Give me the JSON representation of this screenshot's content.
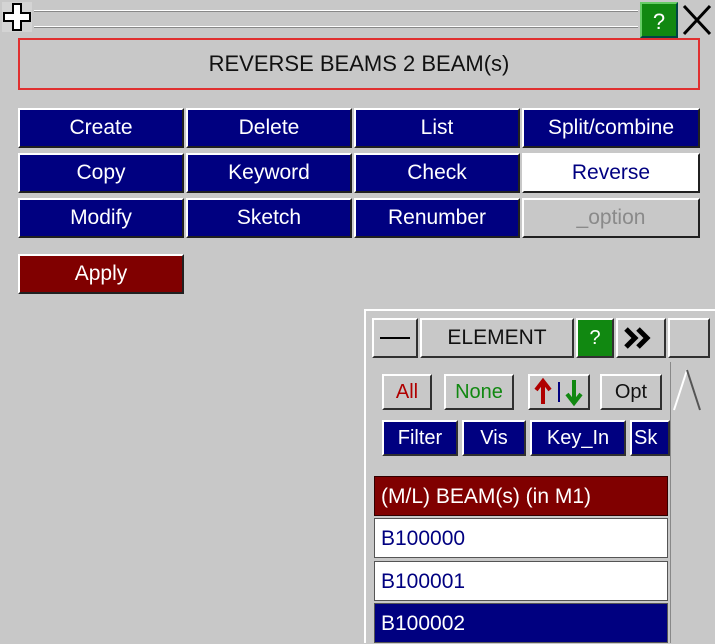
{
  "title_bar": {
    "move_icon": "move-cross-icon",
    "help_label": "?",
    "close_icon": "close-x-icon"
  },
  "header": {
    "title": "REVERSE BEAMS 2 BEAM(s)"
  },
  "grid": {
    "row1": [
      "Create",
      "Delete",
      "List",
      "Split/combine"
    ],
    "row2": [
      "Copy",
      "Keyword",
      "Check",
      "Reverse"
    ],
    "row3": [
      "Modify",
      "Sketch",
      "Renumber",
      "_option"
    ]
  },
  "apply_label": "Apply",
  "panel": {
    "title": "ELEMENT",
    "help_label": "?",
    "minimize_icon": "minimize-icon",
    "expand_icon": "double-chevron-right-icon",
    "all_label": "All",
    "none_label": "None",
    "sort_icon": "sort-up-down-icon",
    "opt_label": "Opt",
    "filter_label": "Filter",
    "vis_label": "Vis",
    "keyin_label": "Key_In",
    "sk_label": "Sk",
    "list_header": "(M/L) BEAM(s) (in M1)",
    "items": [
      "B100000",
      "B100001",
      "B100002"
    ]
  },
  "colors": {
    "navy": "#000080",
    "maroon": "#800000",
    "green": "#118811",
    "background": "#c8c8c8"
  }
}
